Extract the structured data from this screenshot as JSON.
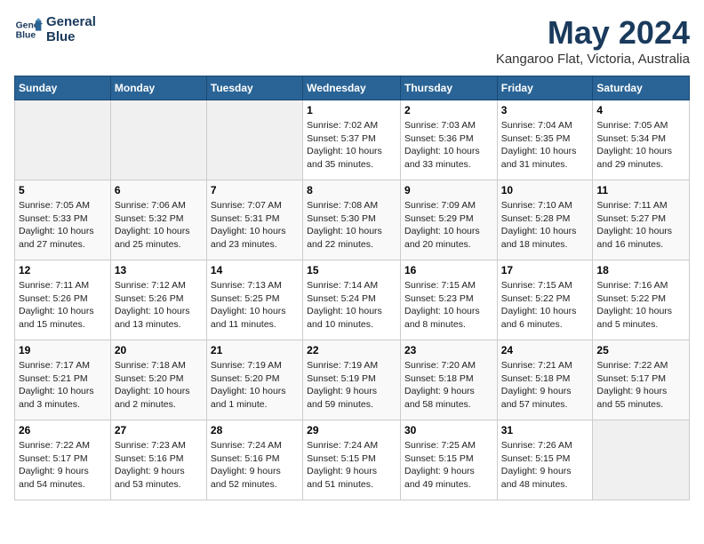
{
  "logo": {
    "line1": "General",
    "line2": "Blue"
  },
  "title": "May 2024",
  "subtitle": "Kangaroo Flat, Victoria, Australia",
  "headers": [
    "Sunday",
    "Monday",
    "Tuesday",
    "Wednesday",
    "Thursday",
    "Friday",
    "Saturday"
  ],
  "weeks": [
    [
      {
        "date": "",
        "info": ""
      },
      {
        "date": "",
        "info": ""
      },
      {
        "date": "",
        "info": ""
      },
      {
        "date": "1",
        "info": "Sunrise: 7:02 AM\nSunset: 5:37 PM\nDaylight: 10 hours\nand 35 minutes."
      },
      {
        "date": "2",
        "info": "Sunrise: 7:03 AM\nSunset: 5:36 PM\nDaylight: 10 hours\nand 33 minutes."
      },
      {
        "date": "3",
        "info": "Sunrise: 7:04 AM\nSunset: 5:35 PM\nDaylight: 10 hours\nand 31 minutes."
      },
      {
        "date": "4",
        "info": "Sunrise: 7:05 AM\nSunset: 5:34 PM\nDaylight: 10 hours\nand 29 minutes."
      }
    ],
    [
      {
        "date": "5",
        "info": "Sunrise: 7:05 AM\nSunset: 5:33 PM\nDaylight: 10 hours\nand 27 minutes."
      },
      {
        "date": "6",
        "info": "Sunrise: 7:06 AM\nSunset: 5:32 PM\nDaylight: 10 hours\nand 25 minutes."
      },
      {
        "date": "7",
        "info": "Sunrise: 7:07 AM\nSunset: 5:31 PM\nDaylight: 10 hours\nand 23 minutes."
      },
      {
        "date": "8",
        "info": "Sunrise: 7:08 AM\nSunset: 5:30 PM\nDaylight: 10 hours\nand 22 minutes."
      },
      {
        "date": "9",
        "info": "Sunrise: 7:09 AM\nSunset: 5:29 PM\nDaylight: 10 hours\nand 20 minutes."
      },
      {
        "date": "10",
        "info": "Sunrise: 7:10 AM\nSunset: 5:28 PM\nDaylight: 10 hours\nand 18 minutes."
      },
      {
        "date": "11",
        "info": "Sunrise: 7:11 AM\nSunset: 5:27 PM\nDaylight: 10 hours\nand 16 minutes."
      }
    ],
    [
      {
        "date": "12",
        "info": "Sunrise: 7:11 AM\nSunset: 5:26 PM\nDaylight: 10 hours\nand 15 minutes."
      },
      {
        "date": "13",
        "info": "Sunrise: 7:12 AM\nSunset: 5:26 PM\nDaylight: 10 hours\nand 13 minutes."
      },
      {
        "date": "14",
        "info": "Sunrise: 7:13 AM\nSunset: 5:25 PM\nDaylight: 10 hours\nand 11 minutes."
      },
      {
        "date": "15",
        "info": "Sunrise: 7:14 AM\nSunset: 5:24 PM\nDaylight: 10 hours\nand 10 minutes."
      },
      {
        "date": "16",
        "info": "Sunrise: 7:15 AM\nSunset: 5:23 PM\nDaylight: 10 hours\nand 8 minutes."
      },
      {
        "date": "17",
        "info": "Sunrise: 7:15 AM\nSunset: 5:22 PM\nDaylight: 10 hours\nand 6 minutes."
      },
      {
        "date": "18",
        "info": "Sunrise: 7:16 AM\nSunset: 5:22 PM\nDaylight: 10 hours\nand 5 minutes."
      }
    ],
    [
      {
        "date": "19",
        "info": "Sunrise: 7:17 AM\nSunset: 5:21 PM\nDaylight: 10 hours\nand 3 minutes."
      },
      {
        "date": "20",
        "info": "Sunrise: 7:18 AM\nSunset: 5:20 PM\nDaylight: 10 hours\nand 2 minutes."
      },
      {
        "date": "21",
        "info": "Sunrise: 7:19 AM\nSunset: 5:20 PM\nDaylight: 10 hours\nand 1 minute."
      },
      {
        "date": "22",
        "info": "Sunrise: 7:19 AM\nSunset: 5:19 PM\nDaylight: 9 hours\nand 59 minutes."
      },
      {
        "date": "23",
        "info": "Sunrise: 7:20 AM\nSunset: 5:18 PM\nDaylight: 9 hours\nand 58 minutes."
      },
      {
        "date": "24",
        "info": "Sunrise: 7:21 AM\nSunset: 5:18 PM\nDaylight: 9 hours\nand 57 minutes."
      },
      {
        "date": "25",
        "info": "Sunrise: 7:22 AM\nSunset: 5:17 PM\nDaylight: 9 hours\nand 55 minutes."
      }
    ],
    [
      {
        "date": "26",
        "info": "Sunrise: 7:22 AM\nSunset: 5:17 PM\nDaylight: 9 hours\nand 54 minutes."
      },
      {
        "date": "27",
        "info": "Sunrise: 7:23 AM\nSunset: 5:16 PM\nDaylight: 9 hours\nand 53 minutes."
      },
      {
        "date": "28",
        "info": "Sunrise: 7:24 AM\nSunset: 5:16 PM\nDaylight: 9 hours\nand 52 minutes."
      },
      {
        "date": "29",
        "info": "Sunrise: 7:24 AM\nSunset: 5:15 PM\nDaylight: 9 hours\nand 51 minutes."
      },
      {
        "date": "30",
        "info": "Sunrise: 7:25 AM\nSunset: 5:15 PM\nDaylight: 9 hours\nand 49 minutes."
      },
      {
        "date": "31",
        "info": "Sunrise: 7:26 AM\nSunset: 5:15 PM\nDaylight: 9 hours\nand 48 minutes."
      },
      {
        "date": "",
        "info": ""
      }
    ]
  ]
}
